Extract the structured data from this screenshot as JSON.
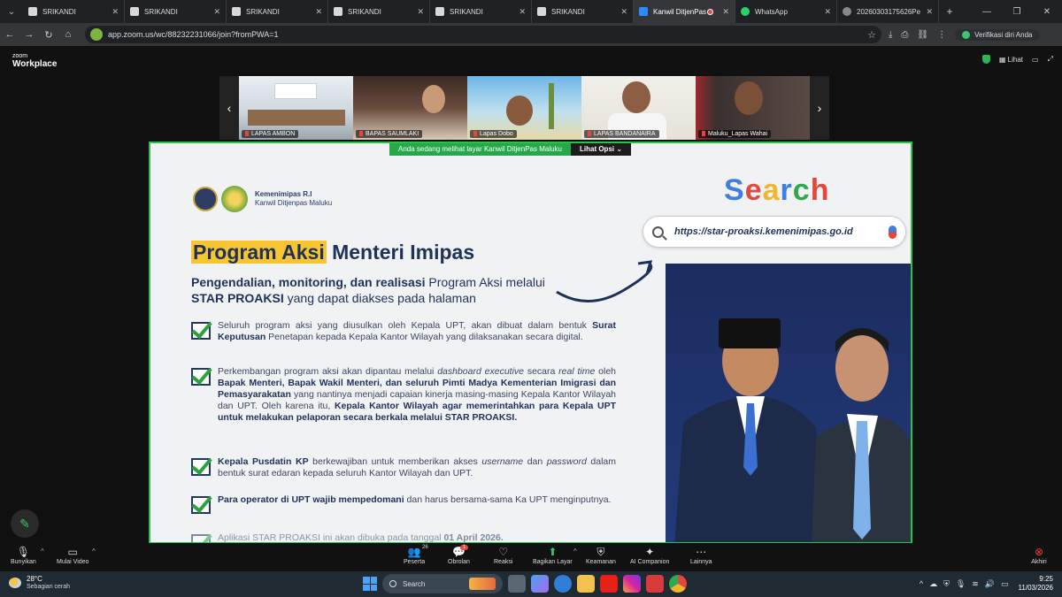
{
  "browser": {
    "tabs": [
      {
        "label": "SRIKANDI",
        "icon": "srikandi-favicon",
        "active": false
      },
      {
        "label": "SRIKANDI",
        "icon": "srikandi-favicon",
        "active": false
      },
      {
        "label": "SRIKANDI",
        "icon": "srikandi-favicon",
        "active": false
      },
      {
        "label": "SRIKANDI",
        "icon": "srikandi-favicon",
        "active": false
      },
      {
        "label": "SRIKANDI",
        "icon": "srikandi-favicon",
        "active": false
      },
      {
        "label": "SRIKANDI",
        "icon": "srikandi-favicon",
        "active": false
      },
      {
        "label": "Kanwil DitjenPas",
        "icon": "zoom-favicon",
        "active": true
      },
      {
        "label": "WhatsApp",
        "icon": "whatsapp-favicon",
        "active": false
      },
      {
        "label": "20260303175626Pe",
        "icon": "globe-favicon",
        "active": false
      }
    ],
    "url": "app.zoom.us/wc/88232231066/join?fromPWA=1",
    "verify_label": "Verifikasi diri Anda"
  },
  "zoom": {
    "logo_top": "zoom",
    "logo_bottom": "Workplace",
    "view_label": "Lihat",
    "participants": [
      {
        "name": "LAPAS AMBON"
      },
      {
        "name": "BAPAS SAUMLAKI"
      },
      {
        "name": "Lapas Dobo"
      },
      {
        "name": "LAPAS BANDANAIRA"
      },
      {
        "name": "Maluku_Lapas Wahai"
      }
    ],
    "viewing_text": "Anda sedang melihat layar  Kanwil DitjenPas Maluku",
    "view_options": "Lihat Opsi",
    "toolbar": {
      "unmute": "Bunyikan",
      "start_video": "Mulai Video",
      "participants": "Peserta",
      "participants_count": "26",
      "chat": "Obrolan",
      "chat_badge": "1",
      "reactions": "Reaksi",
      "share_screen": "Bagikan Layar",
      "security": "Keamanan",
      "ai_companion": "AI Companion",
      "more": "Lainnya",
      "end": "Akhiri"
    }
  },
  "slide": {
    "org_line1": "Kemenimipas R.I",
    "org_line2": "Kanwil Ditjenpas Maluku",
    "headline_highlight": "Program Aksi",
    "headline_rest": " Menteri Imipas",
    "sub_bold1": "Pengendalian, monitoring, dan realisasi",
    "sub_text1": " Program Aksi melalui ",
    "sub_bold2": "STAR PROAKSI",
    "sub_text2": " yang dapat diakses pada halaman",
    "search_word": "Search",
    "search_url": "https://star-proaksi.kemenimipas.go.id",
    "bullet1_a": "Seluruh program aksi yang diusulkan oleh Kepala UPT, akan dibuat dalam bentuk ",
    "bullet1_b": "Surat Keputusan",
    "bullet1_c": " Penetapan kepada Kepala Kantor Wilayah yang dilaksanakan secara digital.",
    "bullet2_a": "Perkembangan program aksi akan dipantau melalui ",
    "bullet2_i1": "dashboard executive",
    "bullet2_b": " secara ",
    "bullet2_i2": "real time",
    "bullet2_c": " oleh ",
    "bullet2_d": "Bapak Menteri, Bapak Wakil Menteri, dan seluruh Pimti Madya Kementerian Imigrasi dan Pemasyarakatan",
    "bullet2_e": " yang nantinya menjadi capaian kinerja masing-masing Kepala Kantor Wilayah dan UPT. Oleh karena itu, ",
    "bullet2_f": "Kepala Kantor Wilayah agar memerintahkan para Kepala UPT untuk melakukan pelaporan secara berkala melalui STAR PROAKSI.",
    "bullet3_a": "Kepala Pusdatin KP",
    "bullet3_b": " berkewajiban untuk memberikan akses ",
    "bullet3_i1": "username",
    "bullet3_c": " dan ",
    "bullet3_i2": "password",
    "bullet3_d": " dalam bentuk surat edaran kepada seluruh Kantor Wilayah dan UPT.",
    "bullet4_a": "Para operator di UPT wajib mempedomani",
    "bullet4_b": " dan harus bersama-sama Ka UPT menginputnya.",
    "bullet5_a": "Aplikasi STAR PROAKSI ini akan dibuka pada tanggal ",
    "bullet5_b": "01 April 2026."
  },
  "taskbar": {
    "temperature": "28°C",
    "weather": "Sebagian cerah",
    "search_placeholder": "Search",
    "time": "9:25",
    "date": "11/03/2026"
  }
}
